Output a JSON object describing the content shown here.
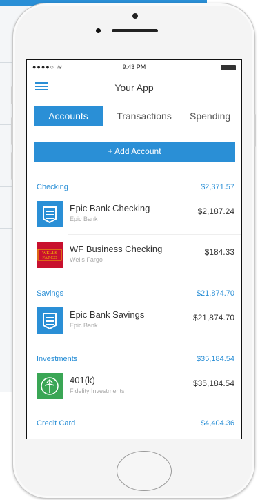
{
  "status_bar": {
    "signal": "●●●●○ ≋",
    "time": "9:43 PM"
  },
  "nav": {
    "title": "Your App"
  },
  "tabs": [
    {
      "label": "Accounts",
      "active": true
    },
    {
      "label": "Transactions",
      "active": false
    },
    {
      "label": "Spending",
      "active": false
    }
  ],
  "add_account": {
    "icon": "plus-icon",
    "label": "+ Add Account"
  },
  "sections": [
    {
      "name": "Checking",
      "total": "$2,371.57",
      "accounts": [
        {
          "name": "Epic Bank Checking",
          "institution": "Epic Bank",
          "amount": "$2,187.24",
          "icon": "epic-bank-logo"
        },
        {
          "name": "WF Business Checking",
          "institution": "Wells Fargo",
          "amount": "$184.33",
          "icon": "wells-fargo-logo",
          "logo_text": "WELLS FARGO"
        }
      ]
    },
    {
      "name": "Savings",
      "total": "$21,874.70",
      "accounts": [
        {
          "name": "Epic Bank Savings",
          "institution": "Epic Bank",
          "amount": "$21,874.70",
          "icon": "epic-bank-logo"
        }
      ]
    },
    {
      "name": "Investments",
      "total": "$35,184.54",
      "accounts": [
        {
          "name": "401(k)",
          "institution": "Fidelity Investments",
          "amount": "$35,184.54",
          "icon": "fidelity-logo"
        }
      ]
    },
    {
      "name": "Credit Card",
      "total": "$4,404.36",
      "accounts": []
    }
  ],
  "colors": {
    "accent": "#2a8fd6",
    "wells_fargo": "#c8102e",
    "fidelity": "#3aa655"
  }
}
